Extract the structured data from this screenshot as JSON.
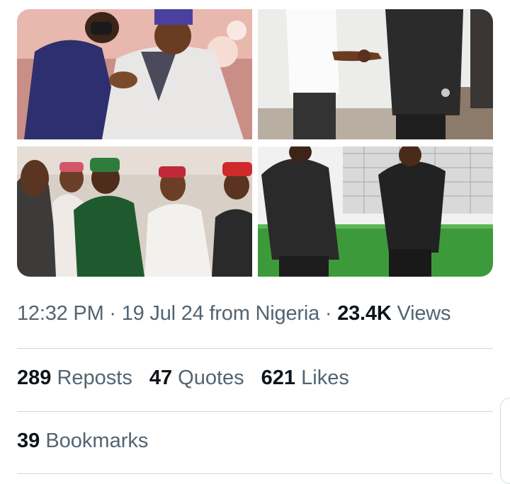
{
  "tweet": {
    "media": [
      {
        "alt": "Two men in traditional attire laughing together at an event"
      },
      {
        "alt": "Two men shaking hands indoors"
      },
      {
        "alt": "Group of men in traditional caps greeting each other"
      },
      {
        "alt": "Two men in black outfits standing on artificial turf"
      }
    ],
    "time": "12:32 PM",
    "separator": "·",
    "date": "19 Jul 24",
    "location_text": "from Nigeria",
    "views_count": "23.4K",
    "views_label": "Views",
    "reposts_count": "289",
    "reposts_label": "Reposts",
    "quotes_count": "47",
    "quotes_label": "Quotes",
    "likes_count": "621",
    "likes_label": "Likes",
    "bookmarks_count": "39",
    "bookmarks_label": "Bookmarks"
  }
}
